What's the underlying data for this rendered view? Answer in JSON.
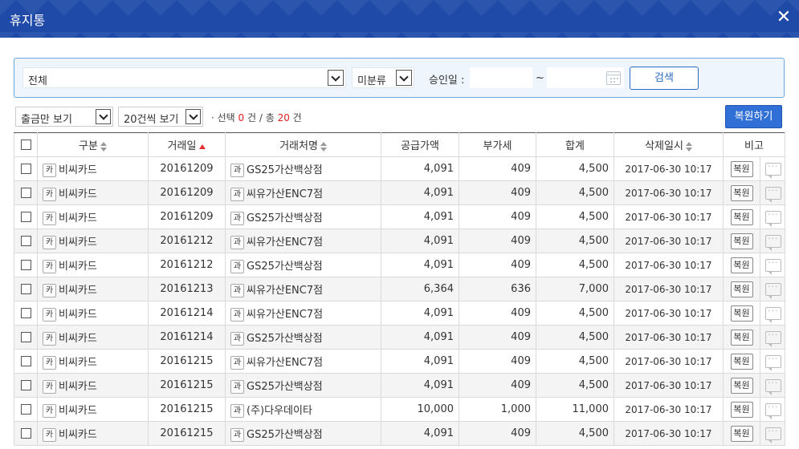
{
  "window": {
    "title": "휴지통",
    "close_icon": "close-icon"
  },
  "search": {
    "type_select": "전체",
    "category_select": "미분류",
    "date_label": "승인일 :",
    "date_from": "",
    "date_sep": "~",
    "date_to": "",
    "search_button": "검색"
  },
  "toolbar": {
    "filter_select": "출금만 보기",
    "page_size_select": "20건씩 보기",
    "count_prefix": "· 선택 ",
    "selected": "0",
    "count_mid": " 건 / 총 ",
    "total": "20",
    "count_suffix": " 건",
    "restore_button": "복원하기"
  },
  "table": {
    "headers": [
      "구분",
      "거래일",
      "거래처명",
      "공급가액",
      "부가세",
      "합계",
      "삭제일시",
      "비고"
    ],
    "badges": {
      "card": "카",
      "merchant": "과"
    },
    "row_action": "복원",
    "rows": [
      {
        "type": "비씨카드",
        "date": "20161209",
        "vendor": "GS25가산백상점",
        "supply": "4,091",
        "vat": "409",
        "total": "4,500",
        "deleted": "2017-06-30 10:17"
      },
      {
        "type": "비씨카드",
        "date": "20161209",
        "vendor": "씨유가산ENC7점",
        "supply": "4,091",
        "vat": "409",
        "total": "4,500",
        "deleted": "2017-06-30 10:17"
      },
      {
        "type": "비씨카드",
        "date": "20161209",
        "vendor": "GS25가산백상점",
        "supply": "4,091",
        "vat": "409",
        "total": "4,500",
        "deleted": "2017-06-30 10:17"
      },
      {
        "type": "비씨카드",
        "date": "20161212",
        "vendor": "씨유가산ENC7점",
        "supply": "4,091",
        "vat": "409",
        "total": "4,500",
        "deleted": "2017-06-30 10:17"
      },
      {
        "type": "비씨카드",
        "date": "20161212",
        "vendor": "GS25가산백상점",
        "supply": "4,091",
        "vat": "409",
        "total": "4,500",
        "deleted": "2017-06-30 10:17"
      },
      {
        "type": "비씨카드",
        "date": "20161213",
        "vendor": "씨유가산ENC7점",
        "supply": "6,364",
        "vat": "636",
        "total": "7,000",
        "deleted": "2017-06-30 10:17"
      },
      {
        "type": "비씨카드",
        "date": "20161214",
        "vendor": "씨유가산ENC7점",
        "supply": "4,091",
        "vat": "409",
        "total": "4,500",
        "deleted": "2017-06-30 10:17"
      },
      {
        "type": "비씨카드",
        "date": "20161214",
        "vendor": "GS25가산백상점",
        "supply": "4,091",
        "vat": "409",
        "total": "4,500",
        "deleted": "2017-06-30 10:17"
      },
      {
        "type": "비씨카드",
        "date": "20161215",
        "vendor": "씨유가산ENC7점",
        "supply": "4,091",
        "vat": "409",
        "total": "4,500",
        "deleted": "2017-06-30 10:17"
      },
      {
        "type": "비씨카드",
        "date": "20161215",
        "vendor": "GS25가산백상점",
        "supply": "4,091",
        "vat": "409",
        "total": "4,500",
        "deleted": "2017-06-30 10:17"
      },
      {
        "type": "비씨카드",
        "date": "20161215",
        "vendor": "(주)다우데이타",
        "supply": "10,000",
        "vat": "1,000",
        "total": "11,000",
        "deleted": "2017-06-30 10:17"
      },
      {
        "type": "비씨카드",
        "date": "20161215",
        "vendor": "GS25가산백상점",
        "supply": "4,091",
        "vat": "409",
        "total": "4,500",
        "deleted": "2017-06-30 10:17"
      }
    ]
  }
}
